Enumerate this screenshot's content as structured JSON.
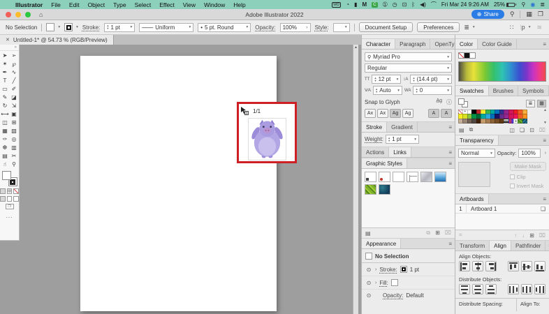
{
  "menubar": {
    "items": [
      "Illustrator",
      "File",
      "Edit",
      "Object",
      "Type",
      "Select",
      "Effect",
      "View",
      "Window",
      "Help"
    ],
    "apple": "",
    "status_icons": [
      {
        "name": "wd-icon",
        "glyph": "WD"
      },
      {
        "name": "meter-icon",
        "glyph": "◔"
      },
      {
        "name": "dark-app-icon",
        "glyph": "▮"
      },
      {
        "name": "maxon-icon",
        "glyph": "M"
      },
      {
        "name": "capture-icon",
        "glyph": "C"
      },
      {
        "name": "onepassword-icon",
        "glyph": "➀"
      },
      {
        "name": "clock-icon",
        "glyph": "◷"
      },
      {
        "name": "display-icon",
        "glyph": "⊡"
      },
      {
        "name": "bluetooth-icon",
        "glyph": "ᛒ"
      },
      {
        "name": "volume-icon",
        "glyph": "◀)"
      },
      {
        "name": "wifi-icon",
        "glyph": "⌒"
      }
    ],
    "clock": "Fri Mar 24 9:26 AM",
    "battery": "25%",
    "search_icon": "⚲",
    "siri_icon": "◉",
    "list_icon": "≣"
  },
  "titlebar": {
    "title": "Adobe Illustrator 2022",
    "share": "Share",
    "share_icon": "⊕",
    "search_icon": "⚲",
    "panel_icon_1": "▦",
    "panel_icon_2": "❐"
  },
  "options": {
    "no_selection": "No Selection",
    "stroke_label": "Stroke:",
    "stroke_value": "1 pt",
    "width_profile": "Uniform",
    "brush_def": "5 pt. Round",
    "brush_dot": "•",
    "opacity_label": "Opacity:",
    "opacity_value": "100%",
    "style_label": "Style:",
    "document_setup": "Document Setup",
    "preferences": "Preferences",
    "align_icon": "≣",
    "grid_icon": "∷",
    "workspace_icon": "≋"
  },
  "doc_tab": {
    "close": "✕",
    "title": "Untitled-1* @ 54.73 % (RGB/Preview)"
  },
  "toolbar": {
    "collapse": "»",
    "tools": [
      {
        "name": "selection-tool",
        "glyph": "➤"
      },
      {
        "name": "direct-selection-tool",
        "glyph": "➢"
      },
      {
        "name": "magic-wand-tool",
        "glyph": "✶"
      },
      {
        "name": "lasso-tool",
        "glyph": "℘"
      },
      {
        "name": "pen-tool",
        "glyph": "✒"
      },
      {
        "name": "curvature-tool",
        "glyph": "∿"
      },
      {
        "name": "type-tool",
        "glyph": "T"
      },
      {
        "name": "line-tool",
        "glyph": "╱"
      },
      {
        "name": "rectangle-tool",
        "glyph": "▭"
      },
      {
        "name": "paintbrush-tool",
        "glyph": "✐"
      },
      {
        "name": "shaper-tool",
        "glyph": "✎"
      },
      {
        "name": "eraser-tool",
        "glyph": "◪"
      },
      {
        "name": "rotate-tool",
        "glyph": "↻"
      },
      {
        "name": "scale-tool",
        "glyph": "⇲"
      },
      {
        "name": "width-tool",
        "glyph": "⟷"
      },
      {
        "name": "free-transform-tool",
        "glyph": "▣"
      },
      {
        "name": "shape-builder-tool",
        "glyph": "◫"
      },
      {
        "name": "perspective-grid-tool",
        "glyph": "⊞"
      },
      {
        "name": "mesh-tool",
        "glyph": "▦"
      },
      {
        "name": "gradient-tool",
        "glyph": "▧"
      },
      {
        "name": "eyedropper-tool",
        "glyph": "✑"
      },
      {
        "name": "blend-tool",
        "glyph": "◎"
      },
      {
        "name": "symbol-sprayer-tool",
        "glyph": "❆"
      },
      {
        "name": "column-graph-tool",
        "glyph": "▥"
      },
      {
        "name": "artboard-tool",
        "glyph": "▤"
      },
      {
        "name": "slice-tool",
        "glyph": "✂"
      },
      {
        "name": "hand-tool",
        "glyph": "☝"
      },
      {
        "name": "zoom-tool",
        "glyph": "⚲"
      }
    ],
    "more": "..."
  },
  "canvas": {
    "frame_label": "1/1"
  },
  "character": {
    "tabs": [
      "Character",
      "Paragraph",
      "OpenType"
    ],
    "search_icon": "⚲",
    "font_family": "Myriad Pro",
    "font_style": "Regular",
    "size_icon": "TT",
    "size_value": "12 pt",
    "leading_icon": "↕A",
    "leading_value": "(14.4 pt)",
    "kerning_icon": "V∕A",
    "kerning_value": "Auto",
    "tracking_icon": "WA",
    "tracking_value": "0",
    "snap_to_glyph": "Snap to Glyph",
    "snap_icon": "A̲g",
    "info_icon": "ⓘ",
    "glyph_buttons": [
      "Ax",
      "Ax",
      "Ag",
      "Ag",
      "A",
      "A"
    ]
  },
  "stroke_panel": {
    "tabs": [
      "Stroke",
      "Gradient"
    ],
    "weight_label": "Weight:",
    "weight_value": "1 pt"
  },
  "actions_links": {
    "tabs": [
      "Actions",
      "Links"
    ]
  },
  "graphic_styles": {
    "title": "Graphic Styles",
    "items": [
      {
        "name": "style-default",
        "kind": "default"
      },
      {
        "name": "style-corner",
        "kind": "corner"
      },
      {
        "name": "style-plain",
        "kind": "plain"
      },
      {
        "name": "style-lines",
        "kind": "lines"
      },
      {
        "name": "style-silver-gradient",
        "kind": "silver"
      },
      {
        "name": "style-blue-gradient",
        "kind": "blue"
      },
      {
        "name": "style-green-texture",
        "kind": "green"
      },
      {
        "name": "style-teal-texture",
        "kind": "teal"
      }
    ],
    "library_icon": "▤",
    "link_icon": "⧉",
    "new_icon": "⊞",
    "trash_icon": "⌧"
  },
  "appearance": {
    "title": "Appearance",
    "no_selection": "No Selection",
    "stroke_label": "Stroke:",
    "stroke_value": "1 pt",
    "fill_label": "Fill:",
    "opacity_label": "Opacity:",
    "opacity_value": "Default"
  },
  "color_panel": {
    "tabs": [
      "Color",
      "Color Guide"
    ]
  },
  "swatches": {
    "tabs": [
      "Swatches",
      "Brushes",
      "Symbols"
    ],
    "rows": [
      [
        "none",
        "registration",
        "#ffffff",
        "#000000",
        "#c1272d",
        "#f9ed32",
        "#39b54a",
        "#00a99d",
        "#0071bc",
        "#2e3192",
        "#93278f",
        "#d4145a",
        "#ed1c24",
        "#f15a24",
        "#fbb03b"
      ],
      [
        "#fcee21",
        "#d9e021",
        "#8cc63f",
        "#009245",
        "#006837",
        "#00a99d",
        "#29abe2",
        "#0071bc",
        "#1b1464",
        "#662d91",
        "#93278f",
        "#d4145a",
        "#ed145b",
        "#f15a24",
        "#f7931e"
      ],
      [
        "#c7b299",
        "#998675",
        "#736357",
        "#534741",
        "#42210b",
        "#c69c6d",
        "#a67c52",
        "#8c6239",
        "#754c24",
        "#603813",
        "gradient-bw",
        "gradient-color",
        "pattern-dots",
        "pattern-green",
        "pattern-blue"
      ]
    ],
    "library_icon": "▤",
    "kind_icon": "⧉",
    "group_icon": "◫",
    "folder_icon": "❏",
    "new_icon": "⊡",
    "trash_icon": "⌧"
  },
  "transparency": {
    "title": "Transparency",
    "blend_mode": "Normal",
    "opacity_label": "Opacity:",
    "opacity_value": "100%",
    "make_mask": "Make Mask",
    "clip": "Clip",
    "invert_mask": "Invert Mask"
  },
  "artboards": {
    "title": "Artboards",
    "rows": [
      {
        "num": "1",
        "name": "Artboard 1"
      }
    ],
    "page_icon": "❏",
    "reorder_icon": "⌗",
    "up_icon": "↑",
    "down_icon": "↓",
    "new_icon": "⊞",
    "trash_icon": "⌧"
  },
  "align": {
    "tabs": [
      "Transform",
      "Align",
      "Pathfinder"
    ],
    "align_objects_label": "Align Objects:",
    "distribute_objects_label": "Distribute Objects:",
    "distribute_spacing_label": "Distribute Spacing:",
    "align_to_label": "Align To:"
  }
}
